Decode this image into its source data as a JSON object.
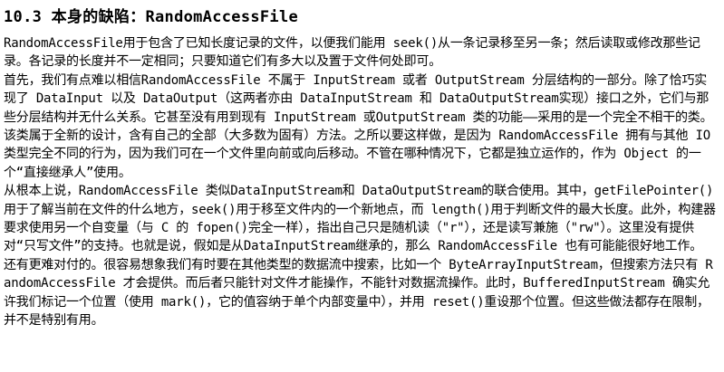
{
  "heading": "10.3 本身的缺陷：RandomAccessFile",
  "paragraphs": [
    "RandomAccessFile用于包含了已知长度记录的文件，以便我们能用 seek()从一条记录移至另一条；然后读取或修改那些记录。各记录的长度并不一定相同；只要知道它们有多大以及置于文件何处即可。",
    "首先，我们有点难以相信RandomAccessFile 不属于 InputStream 或者 OutputStream 分层结构的一部分。除了恰巧实现了 DataInput 以及 DataOutput（这两者亦由 DataInputStream 和 DataOutputStream实现）接口之外，它们与那些分层结构并无什么关系。它甚至没有用到现有 InputStream 或OutputStream 类的功能——采用的是一个完全不相干的类。该类属于全新的设计，含有自己的全部（大多数为固有）方法。之所以要这样做，是因为 RandomAccessFile 拥有与其他 IO类型完全不同的行为，因为我们可在一个文件里向前或向后移动。不管在哪种情况下，它都是独立运作的，作为 Object 的一个“直接继承人”使用。",
    "从根本上说，RandomAccessFile 类似DataInputStream和 DataOutputStream的联合使用。其中，getFilePointer()用于了解当前在文件的什么地方，seek()用于移至文件内的一个新地点，而 length()用于判断文件的最大长度。此外，构建器要求使用另一个自变量（与 C 的 fopen()完全一样），指出自己只是随机读（\"r\"），还是读写兼施（\"rw\"）。这里没有提供对“只写文件”的支持。也就是说，假如是从DataInputStream继承的，那么 RandomAccessFile 也有可能能很好地工作。",
    "还有更难对付的。很容易想象我们有时要在其他类型的数据流中搜索，比如一个 ByteArrayInputStream，但搜索方法只有 RandomAccessFile 才会提供。而后者只能针对文件才能操作，不能针对数据流操作。此时，BufferedInputStream 确实允许我们标记一个位置（使用 mark()，它的值容纳于单个内部变量中），并用 reset()重设那个位置。但这些做法都存在限制，并不是特别有用。"
  ]
}
